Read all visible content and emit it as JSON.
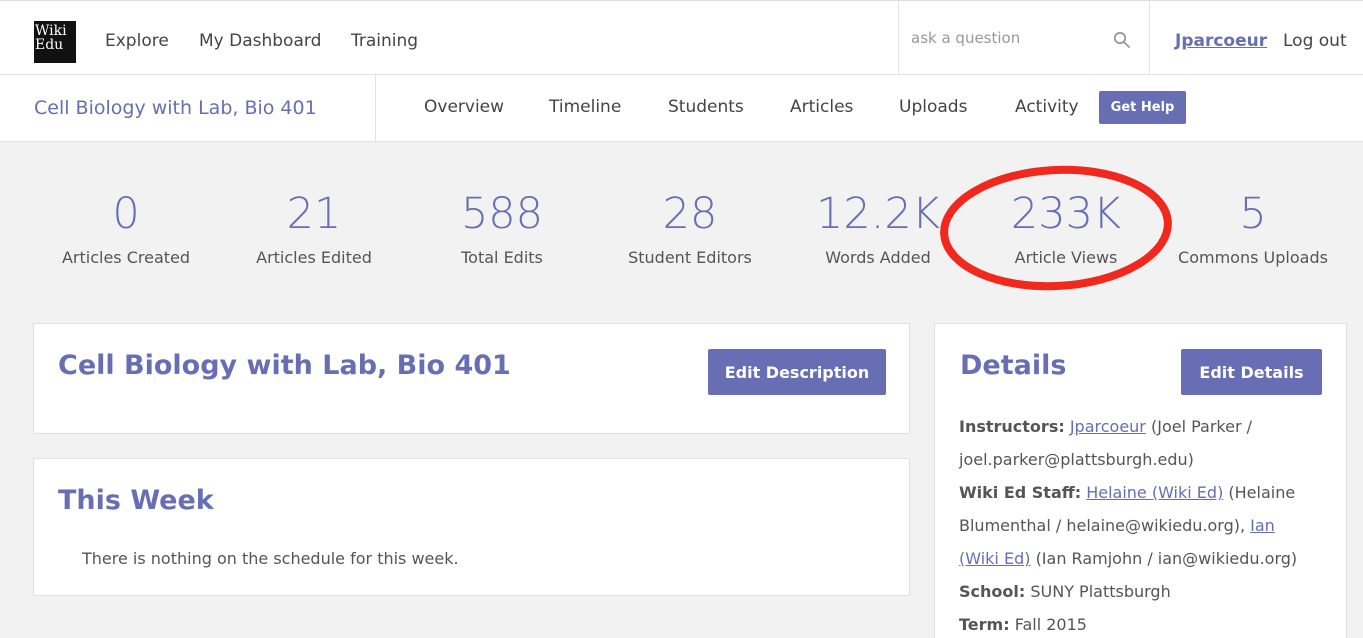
{
  "header": {
    "logo_line1": "Wiki",
    "logo_line2": "Edu",
    "nav": [
      "Explore",
      "My Dashboard",
      "Training"
    ],
    "search_placeholder": "ask a question",
    "user": "Jparcoeur",
    "logout": "Log out"
  },
  "course_bar": {
    "title": "Cell Biology with Lab, Bio 401",
    "tabs": [
      "Overview",
      "Timeline",
      "Students",
      "Articles",
      "Uploads",
      "Activity"
    ],
    "help_button": "Get Help"
  },
  "stats": [
    {
      "value": "0",
      "label": "Articles Created"
    },
    {
      "value": "21",
      "label": "Articles Edited"
    },
    {
      "value": "588",
      "label": "Total Edits"
    },
    {
      "value": "28",
      "label": "Student Editors"
    },
    {
      "value": "12.2K",
      "label": "Words Added"
    },
    {
      "value": "233K",
      "label": "Article Views"
    },
    {
      "value": "5",
      "label": "Commons Uploads"
    }
  ],
  "annotation_color": "#f0281e",
  "accent_color": "#676eb4",
  "description_panel": {
    "title": "Cell Biology with Lab, Bio 401",
    "button": "Edit Description"
  },
  "this_week_panel": {
    "title": "This Week",
    "text": "There is nothing on the schedule for this week."
  },
  "details_panel": {
    "title": "Details",
    "button": "Edit Details",
    "instructors_label": "Instructors:",
    "instructor_link": "Jparcoeur",
    "instructor_info": "(Joel Parker / joel.parker@plattsburgh.edu)",
    "staff_label": "Wiki Ed Staff:",
    "staff1_link": "Helaine (Wiki Ed)",
    "staff1_info": "(Helaine Blumenthal / helaine@wikiedu.org),",
    "staff2_link": "Ian (Wiki Ed)",
    "staff2_info": "(Ian Ramjohn / ian@wikiedu.org)",
    "school_label": "School:",
    "school": "SUNY Plattsburgh",
    "term_label": "Term:",
    "term": "Fall 2015"
  }
}
